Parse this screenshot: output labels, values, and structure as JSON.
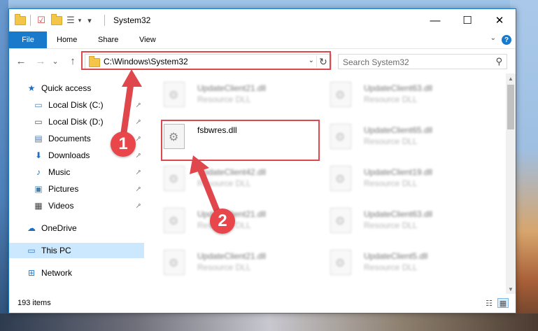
{
  "window": {
    "title": "System32",
    "minimize": "—",
    "maximize": "☐",
    "close": "✕"
  },
  "quick_access_toolbar": {
    "separator": "|",
    "dropdown": "▾"
  },
  "ribbon": {
    "file_tab": "File",
    "tabs": [
      "Home",
      "Share",
      "View"
    ],
    "collapse": "⌄",
    "help": "?"
  },
  "nav": {
    "back": "←",
    "forward": "→",
    "recent": "⌄",
    "up": "↑",
    "address_path": "C:\\Windows\\System32",
    "address_dropdown": "⌄",
    "refresh": "↻",
    "search_placeholder": "Search System32",
    "search_value": ""
  },
  "sidebar": {
    "items": [
      {
        "label": "Quick access",
        "icon": "star-icon",
        "glyph": "★",
        "color": "#1a6fc9",
        "pinned": false,
        "selected": false
      },
      {
        "label": "Local Disk (C:)",
        "icon": "drive-icon",
        "glyph": "▭",
        "color": "#4a7fa8",
        "pinned": true,
        "selected": false
      },
      {
        "label": "Local Disk (D:)",
        "icon": "drive-icon",
        "glyph": "▭",
        "color": "#555555",
        "pinned": true,
        "selected": false
      },
      {
        "label": "Documents",
        "icon": "documents-icon",
        "glyph": "▤",
        "color": "#4a76a8",
        "pinned": true,
        "selected": false
      },
      {
        "label": "Downloads",
        "icon": "download-icon",
        "glyph": "⬇",
        "color": "#1a6fc9",
        "pinned": true,
        "selected": false
      },
      {
        "label": "Music",
        "icon": "music-icon",
        "glyph": "♪",
        "color": "#1a6fc9",
        "pinned": true,
        "selected": false
      },
      {
        "label": "Pictures",
        "icon": "pictures-icon",
        "glyph": "▣",
        "color": "#4a7fa8",
        "pinned": true,
        "selected": false
      },
      {
        "label": "Videos",
        "icon": "video-icon",
        "glyph": "▦",
        "color": "#444444",
        "pinned": true,
        "selected": false
      },
      {
        "label": "OneDrive",
        "icon": "cloud-icon",
        "glyph": "☁",
        "color": "#1a6fc9",
        "pinned": false,
        "selected": false
      },
      {
        "label": "This PC",
        "icon": "computer-icon",
        "glyph": "▭",
        "color": "#2a7ac2",
        "pinned": false,
        "selected": true
      },
      {
        "label": "Network",
        "icon": "network-icon",
        "glyph": "⊞",
        "color": "#2a7ac2",
        "pinned": false,
        "selected": false
      }
    ],
    "pin_glyph": "📌"
  },
  "files": [
    {
      "name": "UpdateClient21.dll",
      "type": "Resource DLL",
      "blurred": true
    },
    {
      "name": "UpdateClient63.dll",
      "type": "Resource DLL",
      "blurred": true
    },
    {
      "name": "fsbwres.dll",
      "type": "",
      "blurred": false
    },
    {
      "name": "UpdateClient65.dll",
      "type": "Resource DLL",
      "blurred": true
    },
    {
      "name": "UpdateClient42.dll",
      "type": "Resource DLL",
      "blurred": true
    },
    {
      "name": "UpdateClient19.dll",
      "type": "Resource DLL",
      "blurred": true
    },
    {
      "name": "UpdateClient21.dll",
      "type": "Resource DLL",
      "blurred": true
    },
    {
      "name": "UpdateClient63.dll",
      "type": "Resource DLL",
      "blurred": true
    },
    {
      "name": "UpdateClient21.dll",
      "type": "Resource DLL",
      "blurred": true
    },
    {
      "name": "UpdateClient5.dll",
      "type": "Resource DLL",
      "blurred": true
    }
  ],
  "status": {
    "item_count": "193 items"
  },
  "annotations": {
    "highlight_color": "#e0474c",
    "badge_color": "#e8464a",
    "badges": [
      "1",
      "2"
    ]
  }
}
